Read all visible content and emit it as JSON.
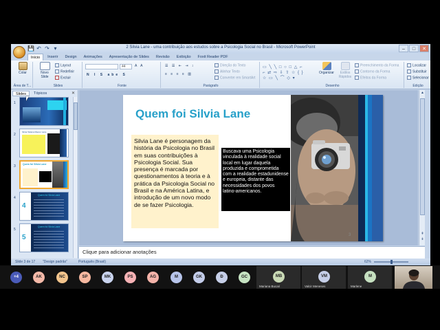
{
  "window": {
    "title": "2 Silvia Lane - uma contribuição aos estudos sobre a Psicologia Social no Brasil - Microsoft PowerPoint",
    "controls": [
      "–",
      "□",
      "✕"
    ]
  },
  "quick_access": [
    "💾",
    "↶",
    "↷",
    "▾"
  ],
  "tabs": [
    "Início",
    "Inserir",
    "Design",
    "Animações",
    "Apresentação de Slides",
    "Revisão",
    "Exibição",
    "Foxit Reader PDF"
  ],
  "active_tab": "Início",
  "ribbon": {
    "clipboard": {
      "paste": "Colar",
      "label": "Área de T..."
    },
    "slides": {
      "new_slide": "Novo Slide",
      "layout": "Layout",
      "reset": "Redefinir",
      "delete": "Excluir",
      "label": "Slides"
    },
    "font": {
      "size": "44",
      "label": "Fonte"
    },
    "paragraph": {
      "text_direction": "Direção do Texto",
      "align_text": "Alinhar Texto",
      "smartart": "Converter em SmartArt",
      "label": "Parágrafo"
    },
    "drawing": {
      "arrange": "Organizar",
      "quick_styles": "Estilos Rápidos",
      "fill": "Preenchimento da Forma",
      "outline": "Contorno da Forma",
      "effects": "Efeitos da Forma",
      "label": "Desenho"
    },
    "editing": {
      "find": "Localizar",
      "replace": "Substituir",
      "select": "Selecionar",
      "label": "Edição"
    }
  },
  "left_pane": {
    "tabs": [
      "Slides",
      "Tópicos"
    ],
    "close": "✕",
    "slides": [
      {
        "num": "1"
      },
      {
        "num": "2",
        "caption": "Silvia Tatiana Maurer Lane"
      },
      {
        "num": "3",
        "caption": "Quem foi Silvia Lane"
      },
      {
        "num": "4",
        "caption": "Quem foi Silvia Lane",
        "big": "4"
      },
      {
        "num": "5",
        "caption": "Quem foi Silvia Lane",
        "big": "5"
      }
    ]
  },
  "slide": {
    "title": "Quem foi Silvia Lane",
    "yellow_text": "Silvia Lane é personagem da história da Psicologia no Brasil em suas contribuições à Psicologia Social. Sua presença é marcada por questionamentos à teoria e à prática da Psicologia Social no Brasil e na América Latina, e introdução de um novo modo de se fazer Psicologia.",
    "black_text": "Buscava uma Psicologia vinculada à realidade social local em lugar daquela produzida e comprometida com a realidade estadunidense e europeia, distante das necessidades dos povos latino-americanos.",
    "number": "3"
  },
  "notes_placeholder": "Clique para adicionar anotações",
  "status": {
    "slide": "Slide 3 de 17",
    "theme": "\"Design padrão\"",
    "language": "Português (Brasil)",
    "zoom": "62%"
  },
  "colors": {
    "title": "#27a0c9",
    "yellow_box": "#fff2cc",
    "ribbon": "#d9e5f3"
  },
  "call": {
    "participants": [
      {
        "initials": "+4",
        "color": "#4a5bb8"
      },
      {
        "initials": "AK",
        "color": "#f4b9a8"
      },
      {
        "initials": "NC",
        "color": "#f3c48c"
      },
      {
        "initials": "SP",
        "color": "#f7b8a0"
      },
      {
        "initials": "MK",
        "color": "#c9d3ee"
      },
      {
        "initials": "PS",
        "color": "#f6b2b5"
      },
      {
        "initials": "AG",
        "color": "#f5b3a9"
      },
      {
        "initials": "M",
        "color": "#b7c4ea"
      },
      {
        "initials": "GK",
        "color": "#c3cce9"
      },
      {
        "initials": "Ð",
        "color": "#c6cfe8"
      },
      {
        "initials": "GC",
        "color": "#c6e3c2"
      }
    ],
    "tiles": [
      {
        "initials": "MB",
        "name": "Mariana Bucari",
        "color": "#c9d9b5"
      },
      {
        "initials": "VM",
        "name": "Valcir Meneses",
        "color": "#c6cfe8"
      },
      {
        "initials": "M",
        "name": "Marlene",
        "color": "#c6e0c0"
      }
    ]
  }
}
